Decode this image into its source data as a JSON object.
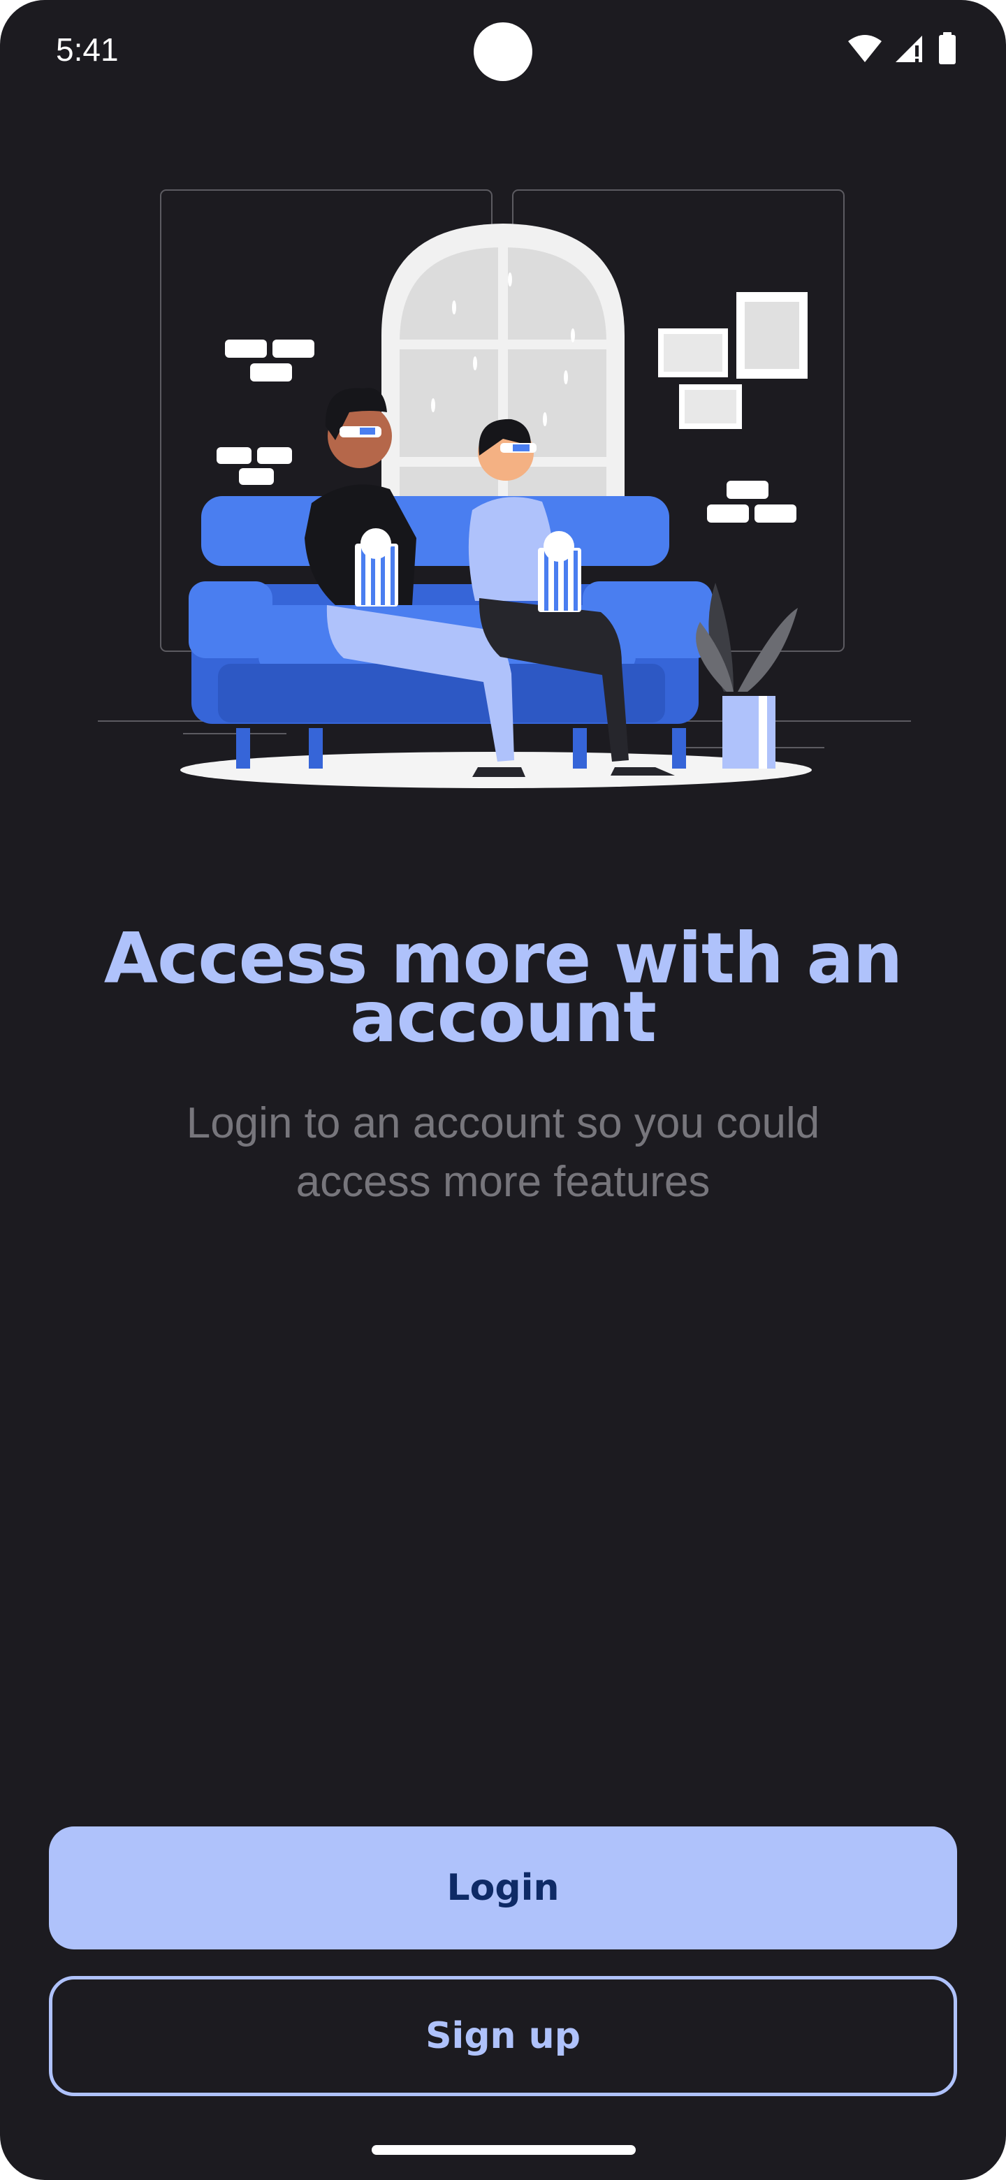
{
  "status_bar": {
    "time": "5:41",
    "icons": [
      "wifi-icon",
      "cellular-signal-icon",
      "battery-icon"
    ]
  },
  "illustration": {
    "description_icon": "couple-watching-movie-illustration"
  },
  "content": {
    "headline": "Access more with an account",
    "subtitle": "Login to an account so you could access more features"
  },
  "actions": {
    "login_label": "Login",
    "signup_label": "Sign up"
  },
  "colors": {
    "background": "#1c1b20",
    "accent": "#afc2fb",
    "accent_text": "#0e2a66",
    "subtitle": "#77767c"
  }
}
